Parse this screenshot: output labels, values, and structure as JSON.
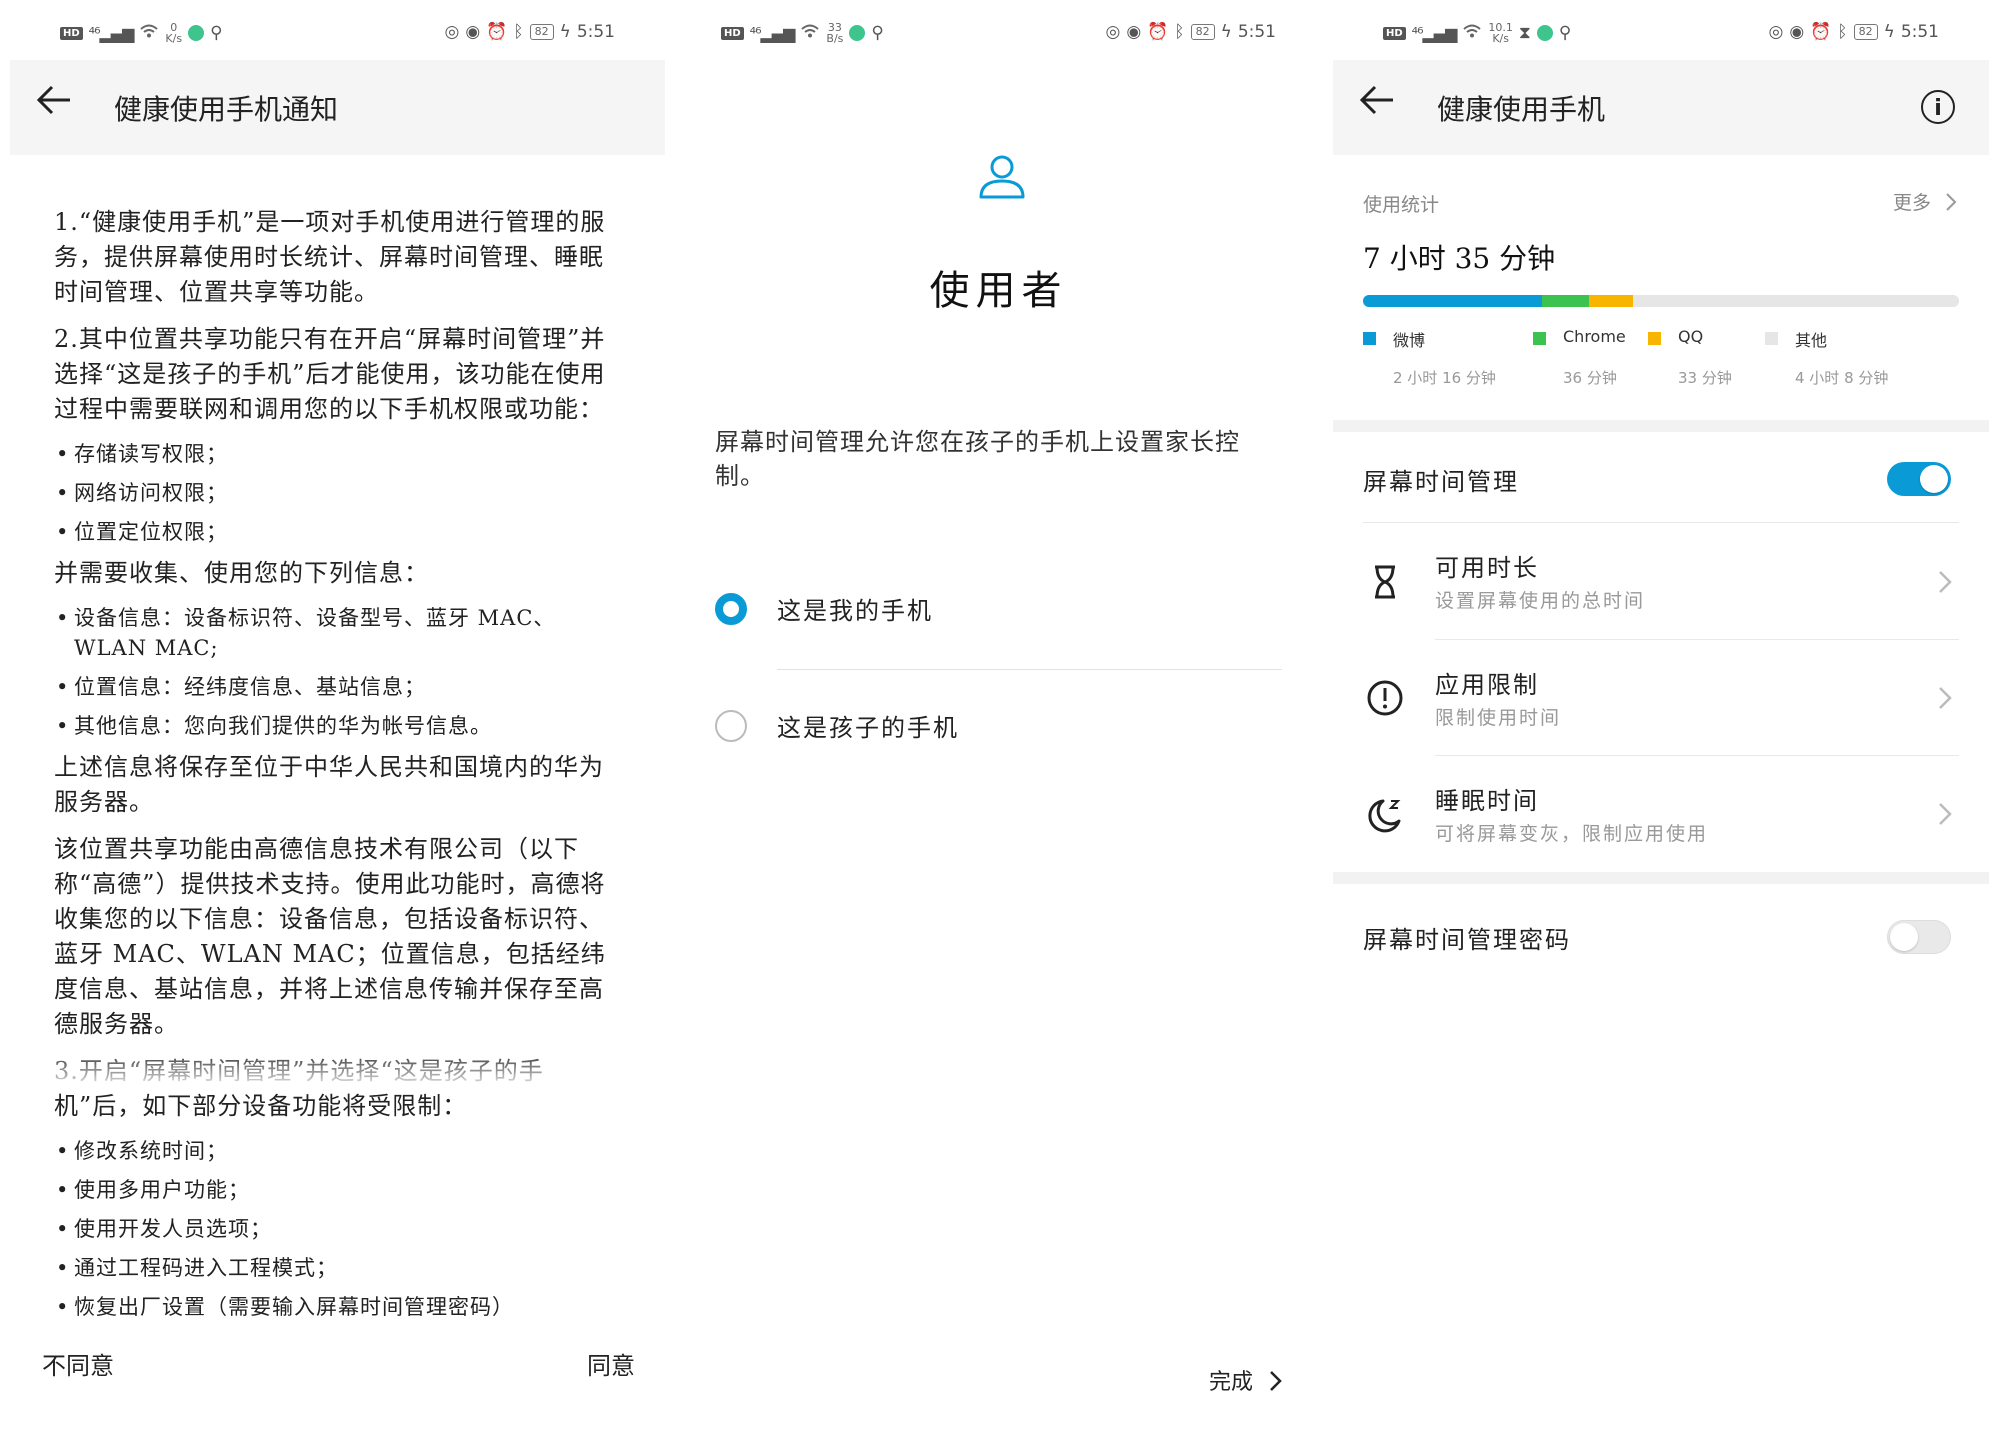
{
  "status_bars": [
    {
      "speed_value": "0",
      "speed_unit": "K/s",
      "battery": "82",
      "time": "5:51"
    },
    {
      "speed_value": "33",
      "speed_unit": "B/s",
      "battery": "82",
      "time": "5:51"
    },
    {
      "speed_value": "10.1",
      "speed_unit": "K/s",
      "battery": "82",
      "time": "5:51"
    }
  ],
  "panel1": {
    "title": "健康使用手机通知",
    "blocks": [
      {
        "kind": "para",
        "text": "1.“健康使用手机”是一项对手机使用进行管理的服务，提供屏幕使用时长统计、屏幕时间管理、睡眠时间管理、位置共享等功能。"
      },
      {
        "kind": "para",
        "text": "2.其中位置共享功能只有在开启“屏幕时间管理”并选择“这是孩子的手机”后才能使用，该功能在使用过程中需要联网和调用您的以下手机权限或功能："
      },
      {
        "kind": "bullet",
        "text": "存储读写权限；"
      },
      {
        "kind": "bullet",
        "text": "网络访问权限；"
      },
      {
        "kind": "bullet",
        "text": "位置定位权限；"
      },
      {
        "kind": "para",
        "text": "并需要收集、使用您的下列信息："
      },
      {
        "kind": "bullet",
        "text": "设备信息：设备标识符、设备型号、蓝牙 MAC、WLAN MAC;"
      },
      {
        "kind": "bullet",
        "text": "位置信息：经纬度信息、基站信息；"
      },
      {
        "kind": "bullet",
        "text": "其他信息：您向我们提供的华为帐号信息。"
      },
      {
        "kind": "para",
        "text": "上述信息将保存至位于中华人民共和国境内的华为服务器。"
      },
      {
        "kind": "para",
        "text": "该位置共享功能由高德信息技术有限公司（以下称“高德”）提供技术支持。使用此功能时，高德将收集您的以下信息：设备信息，包括设备标识符、蓝牙 MAC、WLAN MAC；位置信息，包括经纬度信息、基站信息，并将上述信息传输并保存至高德服务器。"
      },
      {
        "kind": "para",
        "text": "3.开启“屏幕时间管理”并选择“这是孩子的手机”后，如下部分设备功能将受限制："
      },
      {
        "kind": "bullet",
        "text": "修改系统时间；"
      },
      {
        "kind": "bullet",
        "text": "使用多用户功能；"
      },
      {
        "kind": "bullet",
        "text": "使用开发人员选项；"
      },
      {
        "kind": "bullet",
        "text": "通过工程码进入工程模式；"
      },
      {
        "kind": "bullet",
        "text": "恢复出厂设置（需要输入屏幕时间管理密码）"
      }
    ],
    "disagree": "不同意",
    "agree": "同意"
  },
  "panel2": {
    "heading": "使用者",
    "description": "屏幕时间管理允许您在孩子的手机上设置家长控制。",
    "options": [
      {
        "label": "这是我的手机",
        "selected": true
      },
      {
        "label": "这是孩子的手机",
        "selected": false
      }
    ],
    "done": "完成",
    "accent": "#0a9bd7"
  },
  "panel3": {
    "title": "健康使用手机",
    "stats_label": "使用统计",
    "more": "更多",
    "total": "7 小时 35 分钟",
    "apps": [
      {
        "name": "微博",
        "time": "2 小时 16 分钟",
        "minutes": 136,
        "color": "#0a9bd7"
      },
      {
        "name": "Chrome",
        "time": "36 分钟",
        "minutes": 36,
        "color": "#3cc24f"
      },
      {
        "name": "QQ",
        "time": "33 分钟",
        "minutes": 33,
        "color": "#f7b500"
      },
      {
        "name": "其他",
        "time": "4 小时 8 分钟",
        "minutes": 248,
        "color": "#e6e6e6"
      }
    ],
    "screen_time_label": "屏幕时间管理",
    "screen_time_on": true,
    "rows": [
      {
        "icon": "hourglass-icon",
        "title": "可用时长",
        "subtitle": "设置屏幕使用的总时间"
      },
      {
        "icon": "alert-icon",
        "title": "应用限制",
        "subtitle": "限制使用时间"
      },
      {
        "icon": "moon-sleep-icon",
        "title": "睡眠时间",
        "subtitle": "可将屏幕变灰，限制应用使用"
      }
    ],
    "password_label": "屏幕时间管理密码",
    "password_on": false
  }
}
